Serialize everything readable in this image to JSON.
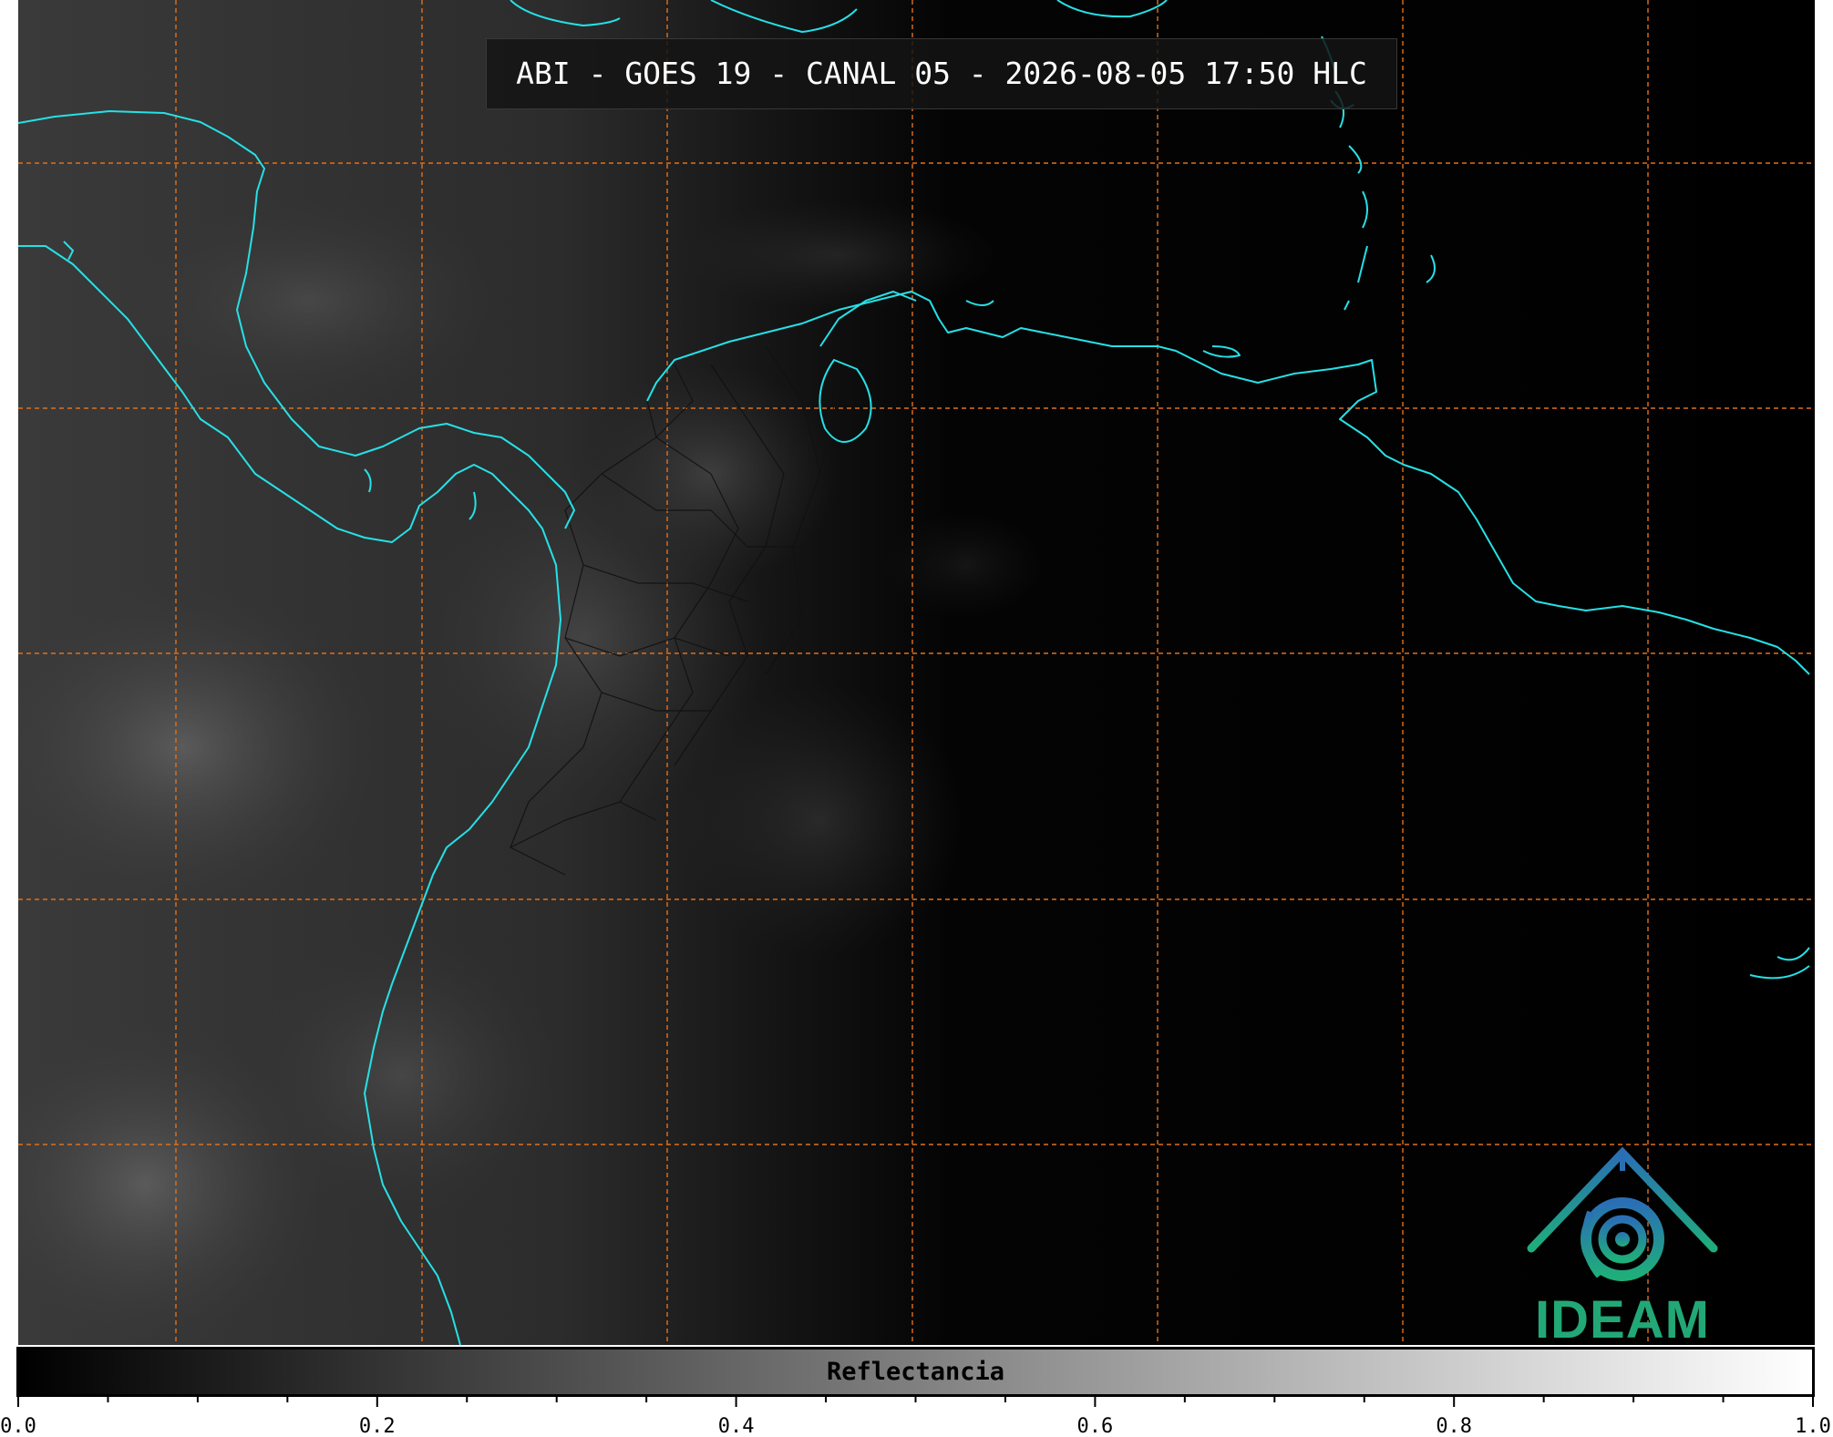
{
  "title": "ABI - GOES 19 - CANAL 05 - 2026-08-05 17:50 HLC",
  "colorbar": {
    "label": "Reflectancia",
    "ticks": [
      "0.0",
      "0.2",
      "0.4",
      "0.6",
      "0.8",
      "1.0"
    ],
    "range": [
      0.0,
      1.0
    ],
    "colormap": "grayscale"
  },
  "logo": {
    "text": "IDEAM"
  },
  "colors": {
    "coastline": "#26e0e6",
    "gridline": "#e0701c",
    "background": "#000000"
  }
}
